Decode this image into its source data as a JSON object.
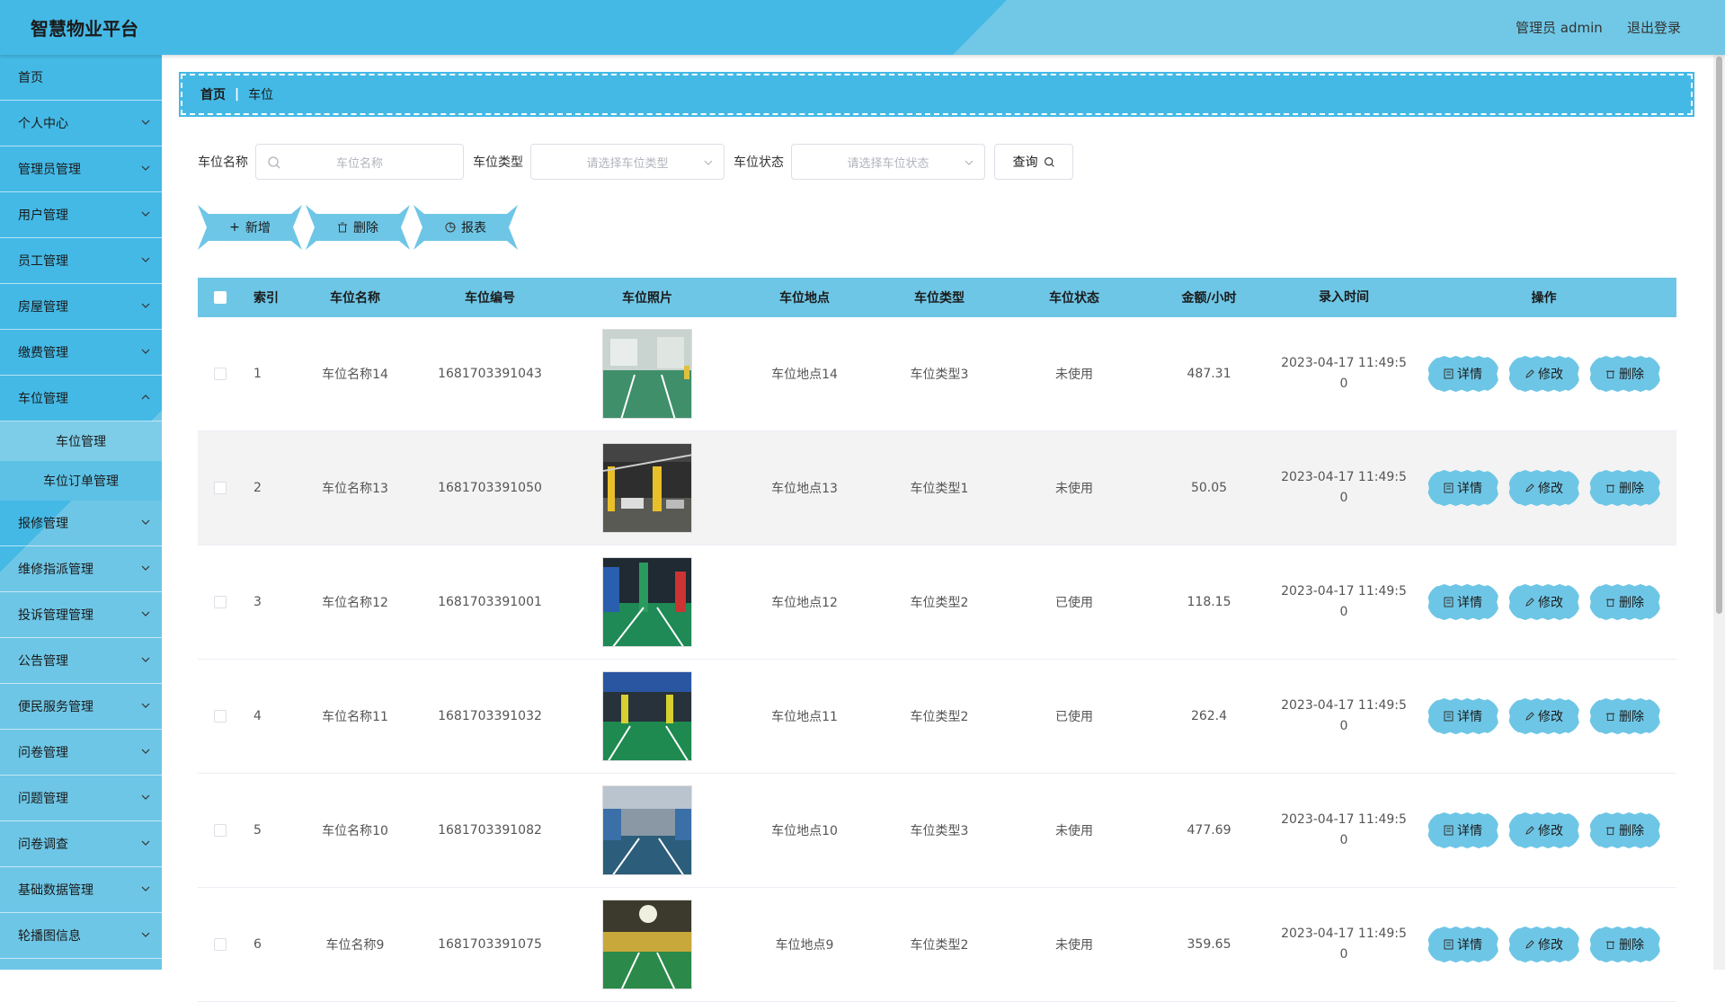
{
  "header": {
    "brand": "智慧物业平台",
    "user": "管理员 admin",
    "logout": "退出登录"
  },
  "sidebar": {
    "items": [
      {
        "label": "首页"
      },
      {
        "label": "个人中心"
      },
      {
        "label": "管理员管理"
      },
      {
        "label": "用户管理"
      },
      {
        "label": "员工管理"
      },
      {
        "label": "房屋管理"
      },
      {
        "label": "缴费管理"
      },
      {
        "label": "车位管理"
      },
      {
        "label": "车位管理"
      },
      {
        "label": "车位订单管理"
      },
      {
        "label": "报修管理"
      },
      {
        "label": "维修指派管理"
      },
      {
        "label": "投诉管理管理"
      },
      {
        "label": "公告管理"
      },
      {
        "label": "便民服务管理"
      },
      {
        "label": "问卷管理"
      },
      {
        "label": "问题管理"
      },
      {
        "label": "问卷调查"
      },
      {
        "label": "基础数据管理"
      },
      {
        "label": "轮播图信息"
      }
    ]
  },
  "breadcrumb": {
    "home": "首页",
    "sep": "|",
    "current": "车位"
  },
  "search": {
    "name_label": "车位名称",
    "name_placeholder": "车位名称",
    "type_label": "车位类型",
    "type_placeholder": "请选择车位类型",
    "status_label": "车位状态",
    "status_placeholder": "请选择车位状态",
    "query": "查询"
  },
  "actions": {
    "add": "新增",
    "delete": "删除",
    "report": "报表"
  },
  "table": {
    "headers": [
      "索引",
      "车位名称",
      "车位编号",
      "车位照片",
      "车位地点",
      "车位类型",
      "车位状态",
      "金额/小时",
      "录入时间",
      "操作"
    ],
    "ops": {
      "detail": "详情",
      "edit": "修改",
      "delete": "删除"
    },
    "rows": [
      {
        "idx": "1",
        "name": "车位名称14",
        "code": "1681703391043",
        "loc": "车位地点14",
        "type": "车位类型3",
        "status": "未使用",
        "amount": "487.31",
        "time1": "2023-04-17 11:49:5",
        "time2": "0"
      },
      {
        "idx": "2",
        "name": "车位名称13",
        "code": "1681703391050",
        "loc": "车位地点13",
        "type": "车位类型1",
        "status": "未使用",
        "amount": "50.05",
        "time1": "2023-04-17 11:49:5",
        "time2": "0"
      },
      {
        "idx": "3",
        "name": "车位名称12",
        "code": "1681703391001",
        "loc": "车位地点12",
        "type": "车位类型2",
        "status": "已使用",
        "amount": "118.15",
        "time1": "2023-04-17 11:49:5",
        "time2": "0"
      },
      {
        "idx": "4",
        "name": "车位名称11",
        "code": "1681703391032",
        "loc": "车位地点11",
        "type": "车位类型2",
        "status": "已使用",
        "amount": "262.4",
        "time1": "2023-04-17 11:49:5",
        "time2": "0"
      },
      {
        "idx": "5",
        "name": "车位名称10",
        "code": "1681703391082",
        "loc": "车位地点10",
        "type": "车位类型3",
        "status": "未使用",
        "amount": "477.69",
        "time1": "2023-04-17 11:49:5",
        "time2": "0"
      },
      {
        "idx": "6",
        "name": "车位名称9",
        "code": "1681703391075",
        "loc": "车位地点9",
        "type": "车位类型2",
        "status": "未使用",
        "amount": "359.65",
        "time1": "2023-04-17 11:49:5",
        "time2": "0"
      }
    ]
  },
  "colors": {
    "primary": "#44b9e6",
    "light": "#6ec6e6"
  }
}
